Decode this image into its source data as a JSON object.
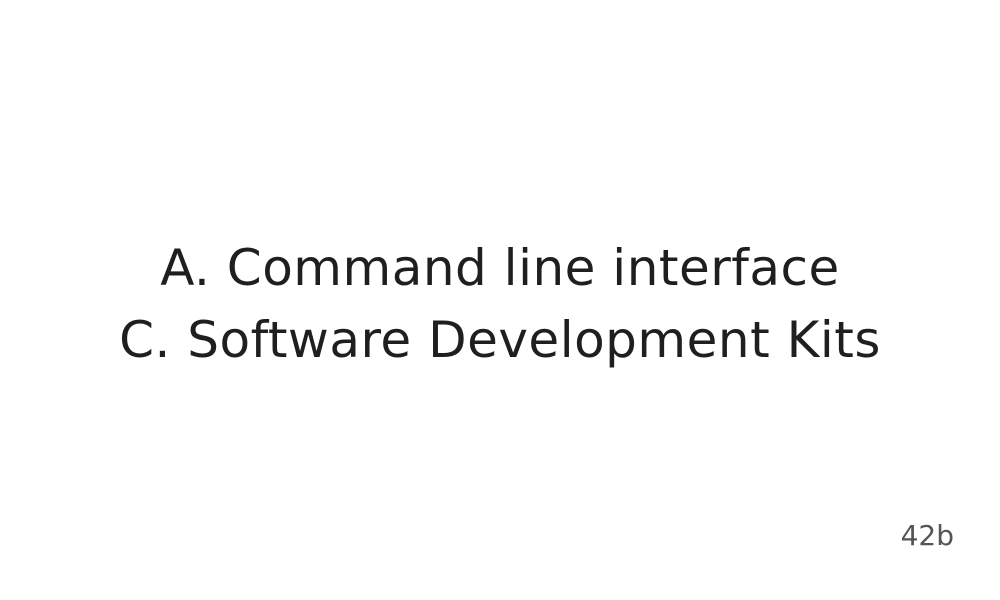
{
  "answers": [
    "A. Command line interface",
    "C. Software Development Kits"
  ],
  "page_label": "42b",
  "colors": {
    "background": "#ffffff",
    "text": "#1f1f1f",
    "page_label": "#555555"
  }
}
